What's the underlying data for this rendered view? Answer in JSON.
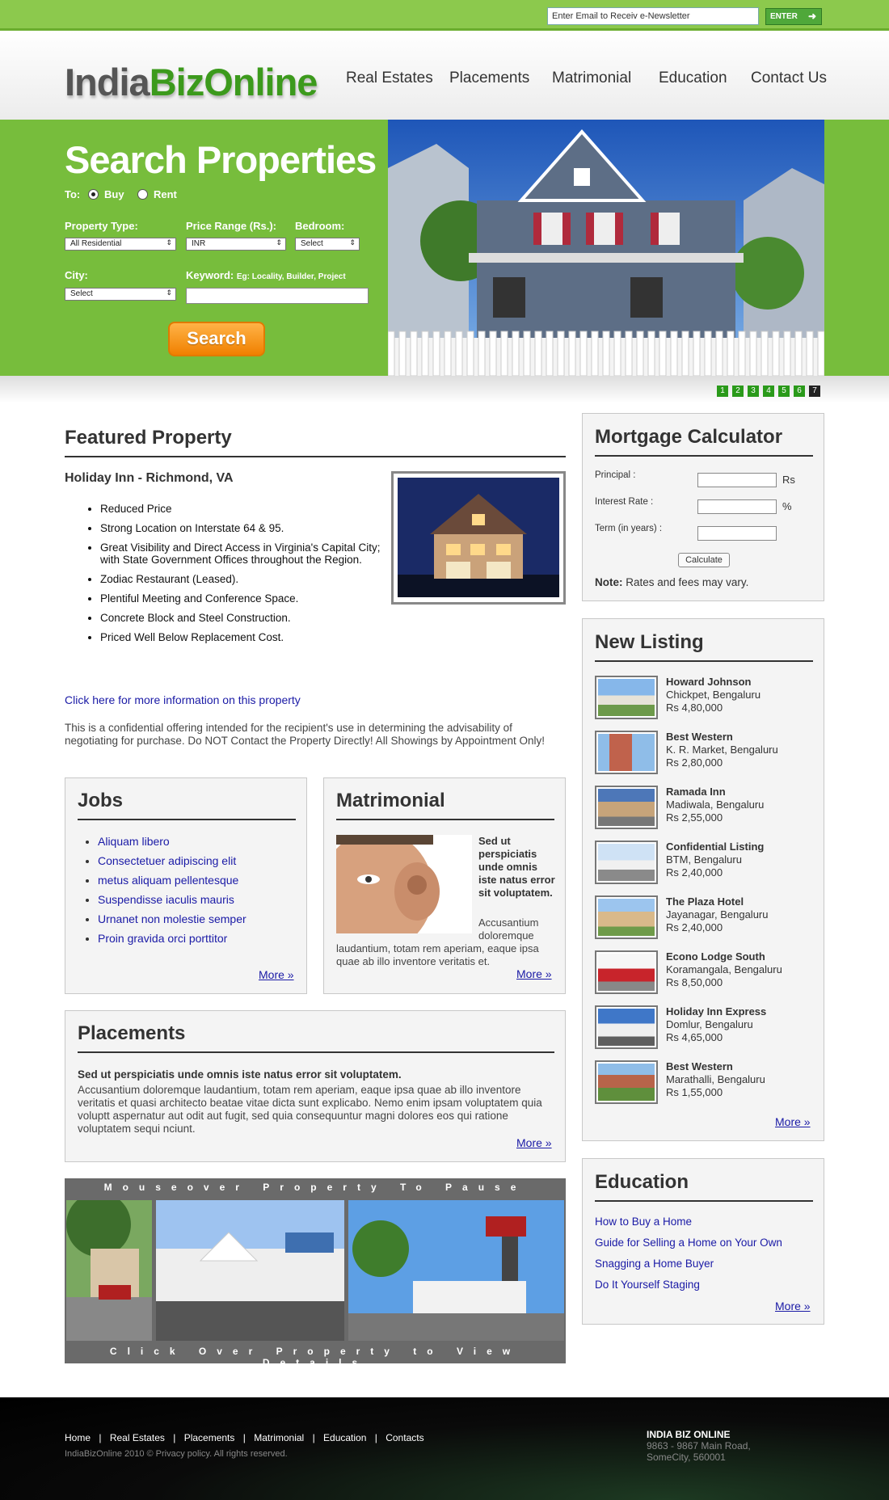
{
  "topbar": {
    "newsletter_value": "Enter Email to Receiv e-Newsletter",
    "enter_label": "ENTER"
  },
  "logo": {
    "part1": "India",
    "part2": "BizOnline"
  },
  "nav": [
    "Real Estates",
    "Placements",
    "Matrimonial",
    "Education",
    "Contact Us"
  ],
  "hero": {
    "title": "Search Properties",
    "to_label": "To:",
    "buy": "Buy",
    "rent": "Rent",
    "property_type_label": "Property Type:",
    "property_type_value": "All Residential",
    "price_label": "Price Range (Rs.):",
    "price_value": "INR",
    "bedroom_label": "Bedroom:",
    "bedroom_value": "Select",
    "city_label": "City:",
    "city_value": "Select",
    "keyword_label": "Keyword:",
    "keyword_hint": "Eg: Locality, Builder, Project",
    "search_button": "Search"
  },
  "slides": [
    "1",
    "2",
    "3",
    "4",
    "5",
    "6",
    "7"
  ],
  "featured": {
    "heading": "Featured Property",
    "title": "Holiday Inn - Richmond, VA",
    "bullets": [
      "Reduced Price",
      "Strong Location on Interstate 64 & 95.",
      "Great Visibility and Direct Access in Virginia's Capital City; with State Government Offices throughout the Region.",
      "Zodiac Restaurant (Leased).",
      "Plentiful Meeting and Conference Space.",
      "Concrete Block and Steel Construction.",
      "Priced Well Below Replacement Cost."
    ],
    "link": "Click here for more information on this property",
    "note": "This is a confidential offering intended for the recipient's use in determining the advisability of negotiating for purchase. Do NOT Contact the Property Directly! All Showings by Appointment Only!"
  },
  "jobs": {
    "heading": "Jobs",
    "links": [
      "Aliquam libero",
      "Consectetuer adipiscing elit",
      "metus aliquam pellentesque",
      "Suspendisse iaculis mauris",
      "Urnanet non molestie semper",
      "Proin gravida orci porttitor"
    ],
    "more": "More »"
  },
  "matrimonial": {
    "heading": "Matrimonial",
    "bold": "Sed ut perspiciatis unde omnis iste natus error sit voluptatem.",
    "text1": "Accusantium doloremque",
    "text2": "laudantium, totam rem aperiam, eaque ipsa quae ab illo inventore veritatis et.",
    "more": "More »"
  },
  "placements": {
    "heading": "Placements",
    "bold": "Sed ut perspiciatis unde omnis iste natus error sit voluptatem.",
    "text": "Accusantium doloremque laudantium, totam rem aperiam, eaque ipsa quae ab illo inventore veritatis et quasi architecto beatae vitae dicta sunt explicabo. Nemo enim ipsam voluptatem quia voluptt aspernatur aut odit aut fugit, sed quia consequuntur magni dolores eos qui ratione voluptatem sequi nciunt.",
    "more": "More »"
  },
  "gallery": {
    "top": "Mouseover Property To Pause",
    "bottom": "Click Over Property to View Details"
  },
  "mortgage": {
    "heading": "Mortgage Calculator",
    "principal": "Principal :",
    "rs": "Rs",
    "rate": "Interest Rate :",
    "pct": "%",
    "term": "Term (in years) :",
    "calc": "Calculate",
    "note_bold": "Note:",
    "note": "Rates and fees may vary."
  },
  "listing": {
    "heading": "New Listing",
    "items": [
      {
        "name": "Howard Johnson",
        "loc": "Chickpet, Bengaluru",
        "price": "Rs 4,80,000"
      },
      {
        "name": "Best Western",
        "loc": "K. R. Market, Bengaluru",
        "price": "Rs 2,80,000"
      },
      {
        "name": "Ramada Inn",
        "loc": "Madiwala, Bengaluru",
        "price": "Rs 2,55,000"
      },
      {
        "name": "Confidential Listing",
        "loc": "BTM, Bengaluru",
        "price": "Rs 2,40,000"
      },
      {
        "name": "The Plaza Hotel",
        "loc": "Jayanagar, Bengaluru",
        "price": "Rs 2,40,000"
      },
      {
        "name": "Econo Lodge South",
        "loc": "Koramangala, Bengaluru",
        "price": "Rs 8,50,000"
      },
      {
        "name": "Holiday Inn Express",
        "loc": "Domlur, Bengaluru",
        "price": "Rs 4,65,000"
      },
      {
        "name": "Best Western",
        "loc": "Marathalli, Bengaluru",
        "price": "Rs 1,55,000"
      }
    ],
    "more": "More »"
  },
  "education": {
    "heading": "Education",
    "links": [
      "How to Buy a Home",
      "Guide for Selling a Home on Your Own",
      "Snagging a Home Buyer",
      "Do It Yourself Staging"
    ],
    "more": "More »"
  },
  "footer": {
    "links": [
      "Home",
      "Real Estates",
      "Placements",
      "Matrimonial",
      "Education",
      "Contacts"
    ],
    "copyright": "IndiaBizOnline 2010 © Privacy policy.  All rights reserved.",
    "company": "INDIA BIZ ONLINE",
    "addr1": "9863 - 9867 Main Road,",
    "addr2": "SomeCity, 560001"
  }
}
